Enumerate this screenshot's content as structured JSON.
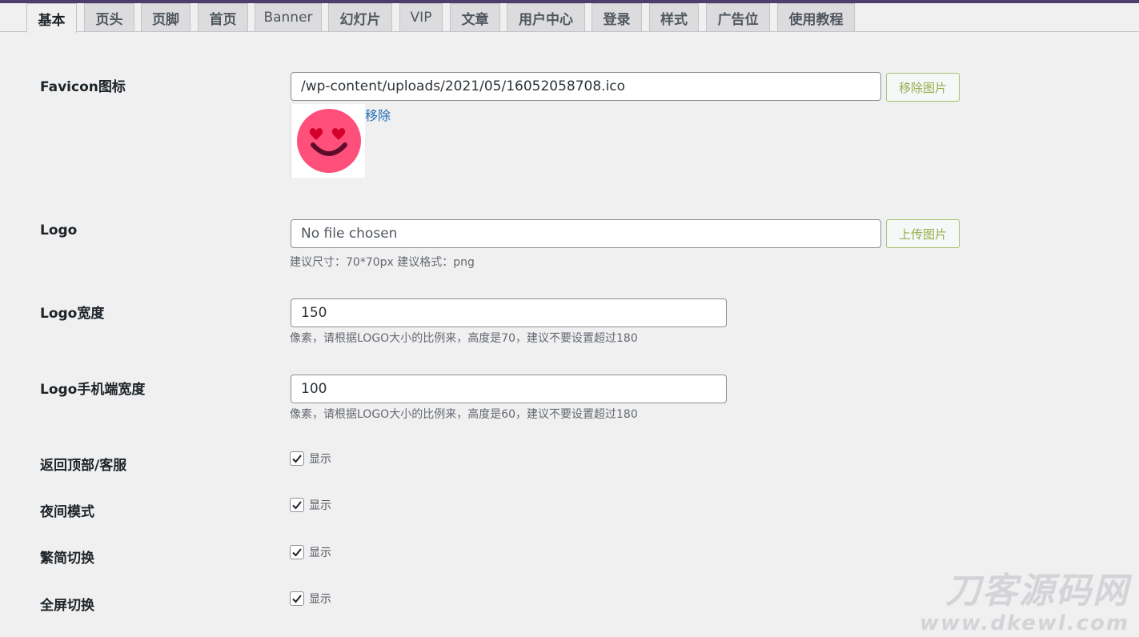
{
  "tabs": [
    "基本",
    "页头",
    "页脚",
    "首页",
    "Banner",
    "幻灯片",
    "VIP",
    "文章",
    "用户中心",
    "登录",
    "样式",
    "广告位",
    "使用教程"
  ],
  "favicon": {
    "label": "Favicon图标",
    "value": "/wp-content/uploads/2021/05/16052058708.ico",
    "remove_button": "移除图片",
    "remove_link": "移除"
  },
  "logo": {
    "label": "Logo",
    "placeholder": "No file chosen",
    "upload_button": "上传图片",
    "hint": "建议尺寸：70*70px 建议格式：png"
  },
  "logo_width": {
    "label": "Logo宽度",
    "value": "150",
    "hint": "像素，请根据LOGO大小的比例来，高度是70，建议不要设置超过180"
  },
  "logo_mobile_width": {
    "label": "Logo手机端宽度",
    "value": "100",
    "hint": "像素，请根据LOGO大小的比例来，高度是60，建议不要设置超过180"
  },
  "toggles": [
    {
      "label": "返回顶部/客服",
      "text": "显示",
      "checked": true
    },
    {
      "label": "夜间模式",
      "text": "显示",
      "checked": true
    },
    {
      "label": "繁简切换",
      "text": "显示",
      "checked": true
    },
    {
      "label": "全屏切换",
      "text": "显示",
      "checked": true
    }
  ],
  "watermark": {
    "cn": "刀客源码网",
    "url": "www.dkewl.com"
  },
  "colors": {
    "accent": "#4f3d6b",
    "button_border": "#a5c26a",
    "link": "#2271b1",
    "emoji": "#ff4f7b"
  }
}
